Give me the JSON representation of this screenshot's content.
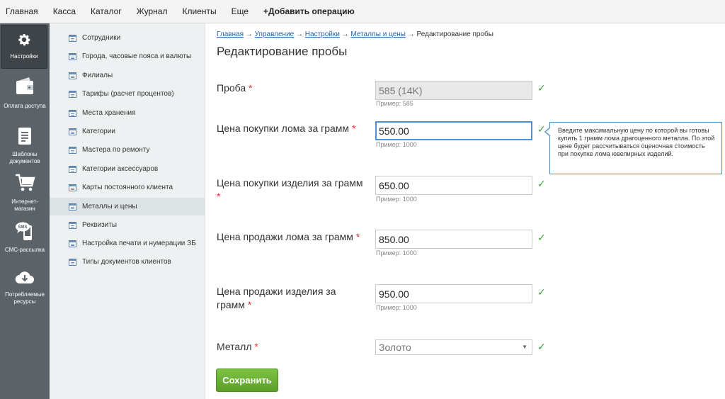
{
  "topnav": {
    "items": [
      "Главная",
      "Касса",
      "Каталог",
      "Журнал",
      "Клиенты",
      "Еще"
    ],
    "add_operation": "+Добавить операцию"
  },
  "iconbar": {
    "items": [
      {
        "label": "Настройки",
        "icon": "gear-icon"
      },
      {
        "label": "Оплата доступа",
        "icon": "wallet-icon"
      },
      {
        "label": "Шаблоны документов",
        "icon": "document-icon"
      },
      {
        "label": "Интернет-магазин",
        "icon": "cart-icon"
      },
      {
        "label": "СМС-рассылка",
        "icon": "sms-phone-icon"
      },
      {
        "label": "Потребляемые ресурсы",
        "icon": "cloud-download-icon"
      }
    ]
  },
  "submenu": {
    "items": [
      "Сотрудники",
      "Города, часовые пояса и валюты",
      "Филиалы",
      "Тарифы (расчет процентов)",
      "Места хранения",
      "Категории",
      "Мастера по ремонту",
      "Категории аксессуаров",
      "Карты постоянного клиента",
      "Металлы и цены",
      "Реквизиты",
      "Настройка печати и нумерации ЗБ",
      "Типы документов клиентов"
    ],
    "active_index": 9
  },
  "breadcrumb": {
    "links": [
      "Главная",
      "Управление",
      "Настройки",
      "Металлы и цены"
    ],
    "separator": "→",
    "current": "Редактирование пробы"
  },
  "page_title": "Редактирование пробы",
  "form": {
    "required_mark": "*",
    "probe": {
      "label": "Проба",
      "value": "585 (14K)",
      "hint": "Пример: 585"
    },
    "scrap_buy": {
      "label": "Цена покупки лома за грамм",
      "value": "550.00",
      "hint": "Пример: 1000"
    },
    "item_buy": {
      "label": "Цена покупки изделия за грамм",
      "value": "650.00",
      "hint": "Пример: 1000"
    },
    "scrap_sell": {
      "label": "Цена продажи лома за грамм",
      "value": "850.00",
      "hint": "Пример: 1000"
    },
    "item_sell": {
      "label": "Цена продажи изделия за грамм",
      "value": "950.00",
      "hint": "Пример: 1000"
    },
    "metal": {
      "label": "Металл",
      "value": "Золото"
    },
    "valid_mark": "✓"
  },
  "tooltip": "Введите максимальную цену по которой вы готовы купить 1 грамм лома драгоценного металла. По этой цене будет рассчитываться оценочная стоимость при покупке лома ювелирных изделий.",
  "save_label": "Сохранить",
  "colors": {
    "accent_link": "#2a5ea8",
    "save_green": "#6ab236",
    "check_green": "#3aa537",
    "required_red": "#ee3333",
    "sidebar_dark": "#5b6268"
  }
}
